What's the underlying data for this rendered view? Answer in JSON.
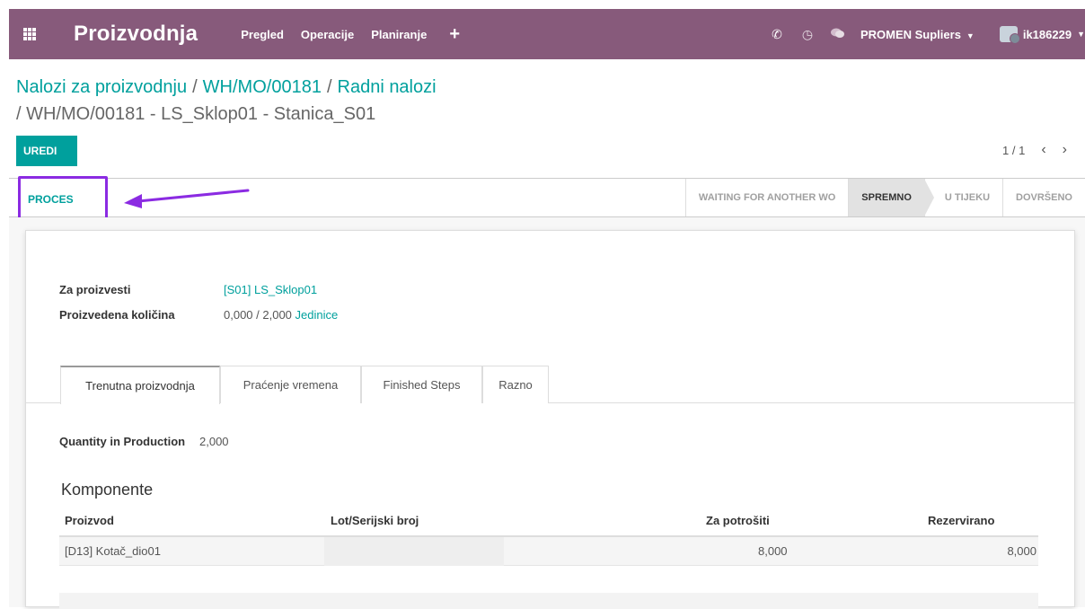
{
  "navbar": {
    "app_name": "Proizvodnja",
    "menus": [
      "Pregled",
      "Operacije",
      "Planiranje"
    ],
    "plus": "+",
    "phone_icon": "✆",
    "clock_icon": "◷",
    "chat_icon": "●",
    "company": "PROMEN Supliers",
    "caret": "▼",
    "user": "ik186229"
  },
  "breadcrumb": {
    "items": [
      "Nalozi za proizvodnju",
      "WH/MO/00181",
      "Radni nalozi"
    ],
    "separator": "/",
    "current": "/ WH/MO/00181 - LS_Sklop01 - Stanica_S01"
  },
  "toolbar": {
    "edit_label": "UREDI",
    "pager": "1 / 1",
    "prev": "‹",
    "next": "›"
  },
  "statusbar": {
    "process_label": "PROCES",
    "stages": [
      {
        "label": "WAITING FOR ANOTHER WO",
        "active": false
      },
      {
        "label": "SPREMNO",
        "active": true
      },
      {
        "label": "U TIJEKU",
        "active": false
      },
      {
        "label": "DOVRŠENO",
        "active": false
      }
    ]
  },
  "form": {
    "to_produce_label": "Za proizvesti",
    "to_produce_value": "[S01] LS_Sklop01",
    "qty_produced_label": "Proizvedena količina",
    "qty_produced_value": "0,000 / 2,000",
    "qty_uom": "Jedinice"
  },
  "tabs": [
    "Trenutna proizvodnja",
    "Praćenje vremena",
    "Finished Steps",
    "Razno"
  ],
  "current_tab": {
    "qty_in_production_label": "Quantity in Production",
    "qty_in_production_value": "2,000",
    "components_title": "Komponente",
    "columns": [
      "Proizvod",
      "Lot/Serijski broj",
      "Za potrošiti",
      "Rezervirano"
    ],
    "rows": [
      {
        "product": "[D13] Kotač_dio01",
        "lot": "",
        "to_consume": "8,000",
        "reserved": "8,000"
      }
    ]
  },
  "colors": {
    "navbar": "#875a7b",
    "accent": "#00a09d",
    "annotation": "#8b2be2"
  }
}
